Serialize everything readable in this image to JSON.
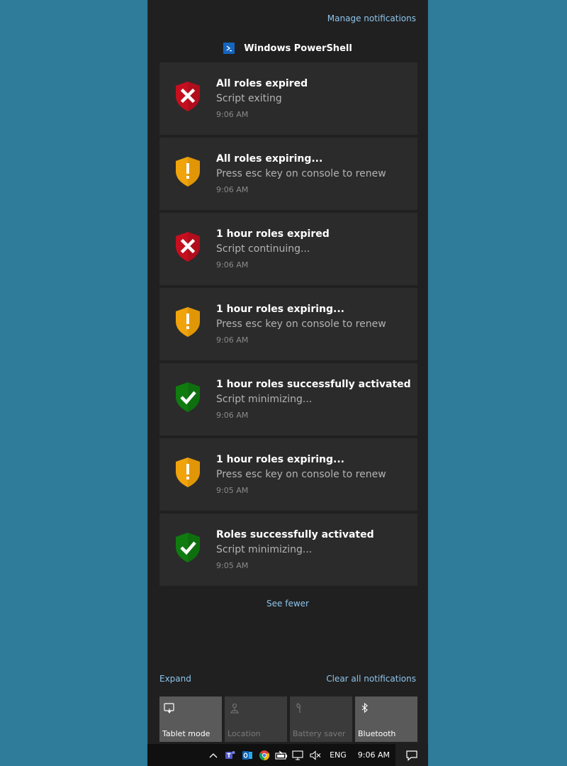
{
  "action_center": {
    "manage_label": "Manage notifications",
    "app_name": "Windows PowerShell",
    "see_fewer_label": "See fewer",
    "expand_label": "Expand",
    "clear_all_label": "Clear all notifications"
  },
  "notifications": [
    {
      "icon": "error-shield-icon",
      "title": "All roles expired",
      "body": "Script exiting",
      "time": "9:06 AM"
    },
    {
      "icon": "warning-shield-icon",
      "title": "All roles expiring...",
      "body": "Press esc key on console to renew",
      "time": "9:06 AM"
    },
    {
      "icon": "error-shield-icon",
      "title": "1 hour roles expired",
      "body": "Script continuing...",
      "time": "9:06 AM"
    },
    {
      "icon": "warning-shield-icon",
      "title": "1 hour roles expiring...",
      "body": "Press esc key on console to renew",
      "time": "9:06 AM"
    },
    {
      "icon": "success-shield-icon",
      "title": "1 hour roles successfully activated",
      "body": "Script minimizing...",
      "time": "9:06 AM"
    },
    {
      "icon": "warning-shield-icon",
      "title": "1 hour roles expiring...",
      "body": "Press esc key on console to renew",
      "time": "9:05 AM"
    },
    {
      "icon": "success-shield-icon",
      "title": "Roles successfully activated",
      "body": "Script minimizing...",
      "time": "9:05 AM"
    }
  ],
  "quick_actions": [
    {
      "label": "Tablet mode",
      "icon": "tablet-mode-icon",
      "active": true
    },
    {
      "label": "Location",
      "icon": "location-icon",
      "active": false
    },
    {
      "label": "Battery saver",
      "icon": "battery-saver-icon",
      "active": false
    },
    {
      "label": "Bluetooth",
      "icon": "bluetooth-icon",
      "active": true
    }
  ],
  "taskbar": {
    "language": "ENG",
    "clock": "9:06 AM",
    "tray_icons": [
      "chevron-up-icon",
      "teams-icon",
      "outlook-icon",
      "chrome-icon",
      "battery-icon",
      "network-icon",
      "volume-muted-icon"
    ]
  },
  "colors": {
    "error": "#c50f1f",
    "warning": "#f0a30a",
    "success": "#107c10",
    "link": "#8ec4ec",
    "background": "#2e7b9a"
  }
}
